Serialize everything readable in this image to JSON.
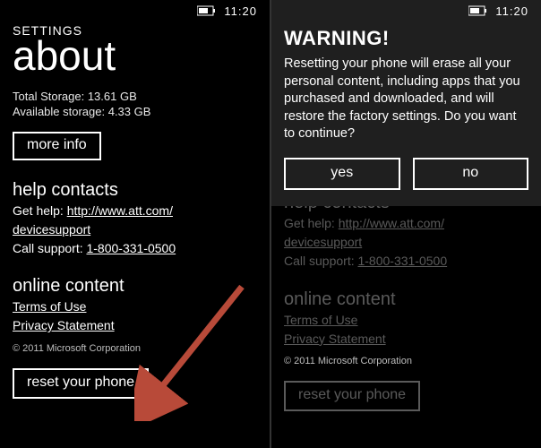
{
  "statusbar": {
    "time": "11:20"
  },
  "left": {
    "section_label": "SETTINGS",
    "title": "about",
    "total_storage_label": "Total Storage: 13.61 GB",
    "available_storage_label": "Available storage: 4.33 GB",
    "more_info_label": "more info",
    "help_heading": "help contacts",
    "get_help_prefix": "Get help: ",
    "get_help_link_line1": "http://www.att.com/",
    "get_help_link_line2": "devicesupport",
    "call_support_prefix": "Call support: ",
    "call_support_number": "1-800-331-0500",
    "online_heading": "online content",
    "terms_label": "Terms of Use",
    "privacy_label": "Privacy Statement",
    "copyright": "© 2011 Microsoft Corporation",
    "reset_label": "reset your phone"
  },
  "right": {
    "warning_title": "WARNING!",
    "warning_body": "Resetting your phone will erase all your personal content, including apps that you purchased and downloaded, and will restore the factory settings. Do you want to continue?",
    "yes_label": "yes",
    "no_label": "no",
    "help_heading": "help contacts",
    "get_help_prefix": "Get help: ",
    "get_help_link_line1": "http://www.att.com/",
    "get_help_link_line2": "devicesupport",
    "call_support_prefix": "Call support: ",
    "call_support_number": "1-800-331-0500",
    "online_heading": "online content",
    "terms_label": "Terms of Use",
    "privacy_label": "Privacy Statement",
    "copyright": "© 2011 Microsoft Corporation",
    "reset_label": "reset your phone"
  },
  "colors": {
    "arrow": "#b84a39"
  }
}
